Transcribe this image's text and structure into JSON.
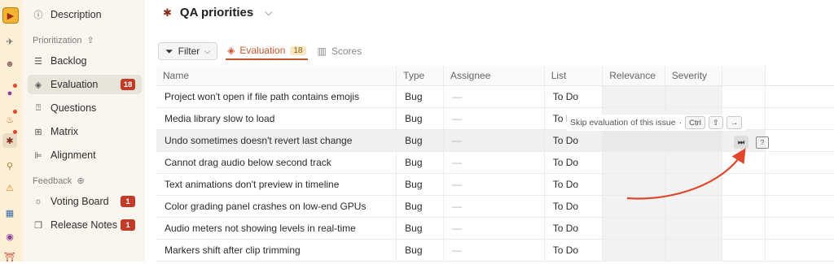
{
  "sidebar": {
    "description": "Description",
    "prioritization_label": "Prioritization",
    "items": [
      {
        "label": "Backlog"
      },
      {
        "label": "Evaluation",
        "badge": "18"
      },
      {
        "label": "Questions"
      },
      {
        "label": "Matrix"
      },
      {
        "label": "Alignment"
      }
    ],
    "feedback_label": "Feedback",
    "feedback_items": [
      {
        "label": "Voting Board",
        "badge": "1"
      },
      {
        "label": "Release Notes",
        "badge": "1"
      }
    ]
  },
  "header": {
    "title": "QA priorities"
  },
  "toolbar": {
    "filter_label": "Filter",
    "tabs": [
      {
        "label": "Evaluation",
        "count": "18"
      },
      {
        "label": "Scores"
      }
    ]
  },
  "table": {
    "columns": [
      "Name",
      "Type",
      "Assignee",
      "List",
      "Relevance",
      "Severity"
    ],
    "rows": [
      {
        "name": "Project won't open if file path contains emojis",
        "type": "Bug",
        "assignee": "—",
        "list": "To Do"
      },
      {
        "name": "Media library slow to load",
        "type": "Bug",
        "assignee": "—",
        "list": "To Do"
      },
      {
        "name": "Undo sometimes doesn't revert last change",
        "type": "Bug",
        "assignee": "—",
        "list": "To Do"
      },
      {
        "name": "Cannot drag audio below second track",
        "type": "Bug",
        "assignee": "—",
        "list": "To Do"
      },
      {
        "name": "Text animations don't preview in timeline",
        "type": "Bug",
        "assignee": "—",
        "list": "To Do"
      },
      {
        "name": "Color grading panel crashes on low-end GPUs",
        "type": "Bug",
        "assignee": "—",
        "list": "To Do"
      },
      {
        "name": "Audio meters not showing levels in real-time",
        "type": "Bug",
        "assignee": "—",
        "list": "To Do"
      },
      {
        "name": "Markers shift after clip trimming",
        "type": "Bug",
        "assignee": "—",
        "list": "To Do"
      }
    ]
  },
  "tooltip": {
    "text": "Skip evaluation of this issue",
    "sep": "·",
    "key_ctrl": "Ctrl",
    "key_shift": "⇧",
    "key_arrow": "→"
  },
  "skip_button": "⏭",
  "question_button": "?",
  "colors": {
    "accent": "#c8562a",
    "badge": "#c23b26",
    "arrow": "#e0472b"
  }
}
